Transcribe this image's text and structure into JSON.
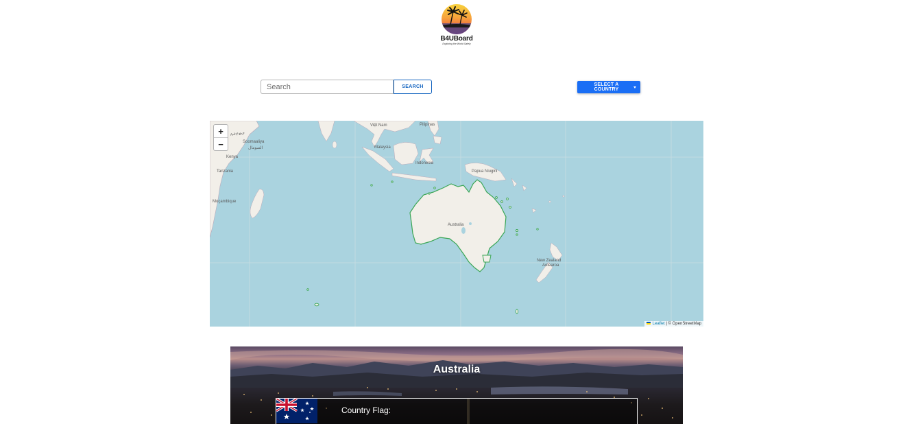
{
  "header": {
    "logo_title": "B4UBoard",
    "logo_tagline": "Exploring the World Safely"
  },
  "search": {
    "placeholder": "Search",
    "value": "",
    "button_label": "SEARCH"
  },
  "country_select": {
    "label": "SELECT A COUNTRY"
  },
  "map": {
    "labels": {
      "philippines": "Pilipinas",
      "vietnam": "Việt Nam",
      "malaysia": "Malaysia",
      "indonesia": "Indonesia",
      "papua": "Papua Niugini",
      "australia": "Australia",
      "nz": "New Zealand",
      "nz2": "Aotearoa",
      "ethiopia": "ኢትዮጵያ",
      "somalia": "Soomaaliya",
      "somalia2": "الصومال",
      "kenya": "Kenya",
      "tanzania": "Tanzania",
      "mozambique": "Moçambique"
    },
    "zoom_in": "+",
    "zoom_out": "−",
    "attribution_leaflet": "Leaflet",
    "attribution_osm": "| © OpenStreetMap",
    "colors": {
      "water": "#aad3df",
      "land": "#f2efe9",
      "highlight": "#3aa655"
    }
  },
  "country": {
    "name": "Australia",
    "flag_label": "Country Flag:"
  }
}
